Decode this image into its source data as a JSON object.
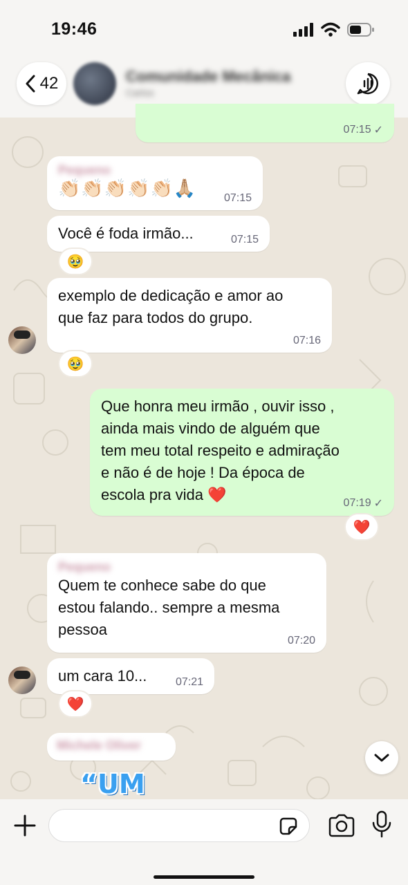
{
  "status_bar": {
    "time": "19:46"
  },
  "header": {
    "back_count": "42",
    "group_name": "Comunidade Mecânica",
    "group_subtitle": "Carlos"
  },
  "messages": [
    {
      "direction": "out",
      "time": "07:15",
      "read": "✓"
    },
    {
      "direction": "in",
      "sender": "Pequeno",
      "text": "👏🏻👏🏻👏🏻👏🏻👏🏻🙏🏼",
      "time": "07:15"
    },
    {
      "direction": "in",
      "text": "Você é foda irmão...",
      "time": "07:15",
      "reaction": "🥹"
    },
    {
      "direction": "in",
      "text_lines": [
        "exemplo de dedicação e amor ao",
        "que faz para todos do grupo."
      ],
      "time": "07:16",
      "reaction": "🥹"
    },
    {
      "direction": "out",
      "text_lines": [
        "Que honra meu irmão , ouvir isso ,",
        "ainda mais vindo de alguém que",
        "tem meu total respeito e admiração",
        "e não é de hoje ! Da época de",
        "escola pra vida ❤️"
      ],
      "time": "07:19",
      "read": "✓",
      "reaction": "❤️"
    },
    {
      "direction": "in",
      "sender": "Pequeno",
      "text_lines": [
        "Quem te conhece sabe do que",
        "estou falando.. sempre a mesma",
        "pessoa"
      ],
      "time": "07:20"
    },
    {
      "direction": "in",
      "text": "um cara 10...",
      "time": "07:21",
      "reaction": "❤️"
    },
    {
      "direction": "in",
      "sender": "Michele Oliver"
    }
  ],
  "sticker_text": "“UM",
  "composer": {
    "placeholder": ""
  },
  "icons": {
    "back": "chevron-left-icon",
    "call": "audio-call-icon",
    "scroll": "chevron-down-icon",
    "plus": "plus-icon",
    "sticker": "sticker-icon",
    "camera": "camera-icon",
    "mic": "microphone-icon"
  },
  "colors": {
    "outgoing_bubble": "#d9fdd3",
    "incoming_bubble": "#ffffff",
    "wallpaper": "#ece6dc"
  }
}
